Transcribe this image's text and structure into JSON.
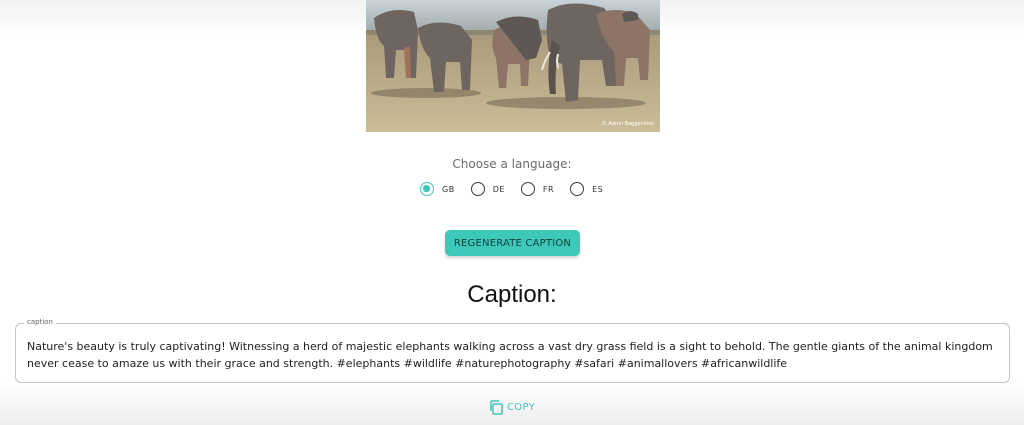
{
  "photo": {
    "alt": "Herd of elephants walking across a dry grass field",
    "credit": "© Aaron Baggenstos"
  },
  "language": {
    "prompt": "Choose a language:",
    "options": [
      {
        "label": "GB",
        "selected": true
      },
      {
        "label": "DE",
        "selected": false
      },
      {
        "label": "FR",
        "selected": false
      },
      {
        "label": "ES",
        "selected": false
      }
    ]
  },
  "regenerate_label": "REGENERATE CAPTION",
  "caption": {
    "heading": "Caption:",
    "field_label": "caption",
    "text": "Nature's beauty is truly captivating! Witnessing a herd of majestic elephants walking across a vast dry grass field is a sight to behold. The gentle giants of the animal kingdom never cease to amaze us with their grace and strength. #elephants #wildlife #naturephotography #safari #animallovers #africanwildlife"
  },
  "copy_label": "COPY",
  "colors": {
    "accent": "#3cc9b9",
    "ground": "#b9aa85",
    "elephant": "#6e6560"
  },
  "icons": {
    "copy": "copy-icon"
  }
}
